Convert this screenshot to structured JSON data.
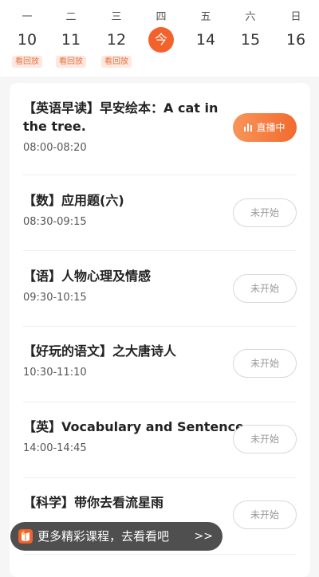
{
  "week": {
    "days": [
      {
        "weekday": "一",
        "date": "10",
        "badge": "看回放"
      },
      {
        "weekday": "二",
        "date": "11",
        "badge": "看回放"
      },
      {
        "weekday": "三",
        "date": "12",
        "badge": "看回放"
      },
      {
        "weekday": "四",
        "date": "今",
        "badge": ""
      },
      {
        "weekday": "五",
        "date": "14",
        "badge": ""
      },
      {
        "weekday": "六",
        "date": "15",
        "badge": ""
      },
      {
        "weekday": "日",
        "date": "16",
        "badge": ""
      }
    ]
  },
  "courses": [
    {
      "title": "【英语早读】早安绘本：A cat in the tree.",
      "time": "08:00-08:20",
      "status": "直播中"
    },
    {
      "title": "【数】应用题(六)",
      "time": "08:30-09:15",
      "status": "未开始"
    },
    {
      "title": "【语】人物心理及情感",
      "time": "09:30-10:15",
      "status": "未开始"
    },
    {
      "title": "【好玩的语文】之大唐诗人",
      "time": "10:30-11:10",
      "status": "未开始"
    },
    {
      "title": "【英】Vocabulary and Sentence",
      "time": "14:00-14:45",
      "status": "未开始"
    },
    {
      "title": "【科学】带你去看流星雨",
      "time": "",
      "status": "未开始"
    }
  ],
  "banner": {
    "text": "更多精彩课程，去看看吧",
    "arrow": ">>"
  },
  "colors": {
    "accent": "#f4622c",
    "badge_bg": "#fde8df",
    "badge_text": "#e4733f"
  }
}
